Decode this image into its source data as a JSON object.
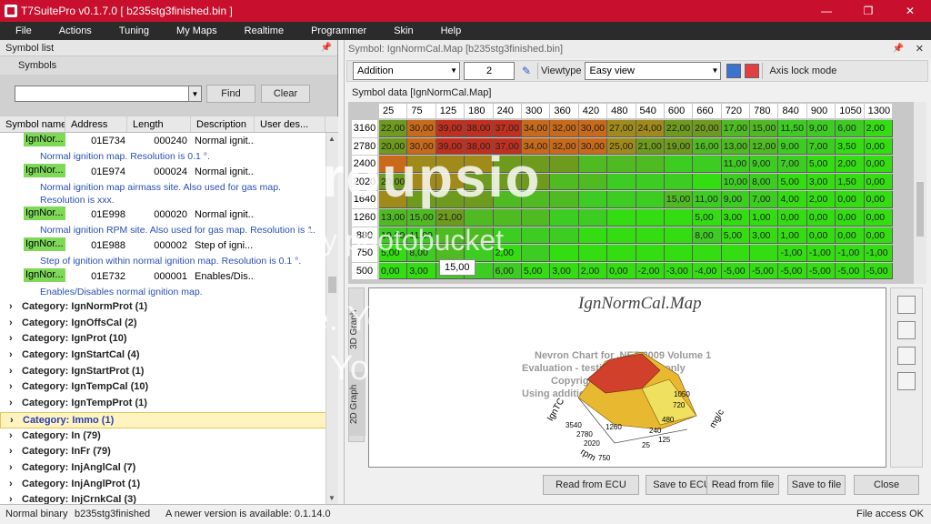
{
  "window": {
    "title": "T7SuitePro v0.1.7.0 [ b235stg3finished.bin ]",
    "min_glyph": "—",
    "max_glyph": "❐",
    "close_glyph": "✕"
  },
  "menu": [
    "File",
    "Actions",
    "Tuning",
    "My Maps",
    "Realtime",
    "Programmer",
    "Skin",
    "Help"
  ],
  "left": {
    "header": "Symbol list",
    "tab": "Symbols",
    "find_label": "Find",
    "clear_label": "Clear",
    "columns": [
      "Symbol name",
      "Address",
      "Length",
      "Description",
      "User des..."
    ],
    "symbols": [
      {
        "name": "IgnNor...",
        "address": "01E734",
        "length": "000240",
        "desc": "Normal ignit...",
        "detail": "Normal ignition map. Resolution is 0.1 °."
      },
      {
        "name": "IgnNor...",
        "address": "01E974",
        "length": "000024",
        "desc": "Normal ignit...",
        "detail": "Normal ignition map airmass site. Also used for gas map. Resolution is xxx."
      },
      {
        "name": "IgnNor...",
        "address": "01E998",
        "length": "000020",
        "desc": "Normal ignit...",
        "detail": "Normal ignition RPM site. Also used for gas map. Resolution is 1."
      },
      {
        "name": "IgnNor...",
        "address": "01E988",
        "length": "000002",
        "desc": "Step of igni...",
        "detail": "Step of ignition within normal ignition map. Resolution is 0.1 °."
      },
      {
        "name": "IgnNor...",
        "address": "01E732",
        "length": "000001",
        "desc": "Enables/Dis...",
        "detail": "Enables/Disables normal ignition map."
      }
    ],
    "categories": [
      "Category: IgnNormProt (1)",
      "Category: IgnOffsCal (2)",
      "Category: IgnProt (10)",
      "Category: IgnStartCal (4)",
      "Category: IgnStartProt (1)",
      "Category: IgnTempCal (10)",
      "Category: IgnTempProt (1)",
      "Category: Immo (1)",
      "Category: In (79)",
      "Category: InFr (79)",
      "Category: InjAnglCal (7)",
      "Category: InjAnglProt (1)",
      "Category: InjCrnkCal (3)"
    ],
    "selected_category": 7
  },
  "right": {
    "header": "Symbol: IgnNormCal.Map [b235stg3finished.bin]",
    "operation": "Addition",
    "value": "2",
    "viewtype_label": "Viewtype",
    "viewtype": "Easy view",
    "axislock_label": "Axis lock mode",
    "symdata_title": "Symbol data [IgnNormCal.Map]",
    "tooltip": "15,00",
    "graph_title": "IgnNormCal.Map",
    "graph_watermark": [
      "Nevron Chart for .NET 2009 Volume 1",
      "Evaluation - testing purposes only",
      "Copyright 1998 - 2009",
      "Using additionally licensed edition"
    ],
    "graph_axes": {
      "rpm": "rpm",
      "igntc": "IgnTC",
      "mgc": "mg/c"
    },
    "graph_ticks_rpm": [
      "3540",
      "2780",
      "2020",
      "1260",
      "750"
    ],
    "graph_ticks_mgc": [
      "1050",
      "720",
      "480",
      "240",
      "125",
      "25"
    ],
    "tab_3d": "3D Graph",
    "tab_2d": "2D Graph",
    "buttons": [
      "Read from ECU",
      "Save to ECU",
      "Read from file",
      "Save to file",
      "Close"
    ],
    "grid": {
      "columns": [
        "25",
        "75",
        "125",
        "180",
        "240",
        "300",
        "360",
        "420",
        "480",
        "540",
        "600",
        "660",
        "720",
        "780",
        "840",
        "900",
        "1050",
        "1300"
      ],
      "rows": [
        "3160",
        "2780",
        "2400",
        "2020",
        "1640",
        "1260",
        "880",
        "750",
        "500"
      ],
      "values": [
        [
          "22,00",
          "30,00",
          "39,00",
          "38,00",
          "37,00",
          "34,00",
          "32,00",
          "30,00",
          "27,00",
          "24,00",
          "22,00",
          "20,00",
          "17,00",
          "15,00",
          "11,50",
          "9,00",
          "6,00",
          "2,00"
        ],
        [
          "20,00",
          "30,00",
          "39,00",
          "38,00",
          "37,00",
          "34,00",
          "32,00",
          "30,00",
          "25,00",
          "21,00",
          "19,00",
          "16,00",
          "13,00",
          "12,00",
          "9,00",
          "7,00",
          "3,50",
          "0,00"
        ],
        [
          "",
          "",
          "",
          "",
          "",
          "",
          "",
          "",
          "",
          "",
          "",
          "",
          "11,00",
          "9,00",
          "7,00",
          "5,00",
          "2,00",
          "0,00"
        ],
        [
          "20,00",
          "",
          "",
          "",
          "",
          "",
          "",
          "",
          "",
          "",
          "",
          "",
          "10,00",
          "8,00",
          "5,00",
          "3,00",
          "1,50",
          "0,00"
        ],
        [
          "",
          "",
          "",
          "",
          "",
          "",
          "",
          "",
          "",
          "",
          "15,00",
          "11,00",
          "9,00",
          "7,00",
          "4,00",
          "2,00",
          "0,00",
          "0,00"
        ],
        [
          "13,00",
          "15,00",
          "21,00",
          "",
          "",
          "",
          "",
          "",
          "",
          "",
          "",
          "5,00",
          "3,00",
          "1,00",
          "0,00",
          "0,00",
          "0,00",
          "0,00"
        ],
        [
          "10,00",
          "11,00",
          "",
          "",
          "",
          "",
          "",
          "",
          "",
          "",
          "",
          "8,00",
          "5,00",
          "3,00",
          "1,00",
          "0,00",
          "0,00",
          "0,00"
        ],
        [
          "5,00",
          "8,00",
          "",
          "",
          "2,00",
          "",
          "",
          "",
          "",
          "",
          "",
          "",
          "",
          "",
          "-1,00",
          "-1,00",
          "-1,00",
          "-1,00"
        ],
        [
          "0,00",
          "3,00",
          "",
          "",
          "6,00",
          "5,00",
          "3,00",
          "2,00",
          "0,00",
          "-2,00",
          "-3,00",
          "-4,00",
          "-5,00",
          "-5,00",
          "-5,00",
          "-5,00",
          "-5,00",
          "-5,00"
        ]
      ]
    }
  },
  "status": {
    "mode": "Normal binary",
    "file": "b235stg3finished",
    "update": "A newer version is available: 0.1.14.0",
    "access": "File access OK"
  },
  "overlay": {
    "logo": "Groupsio",
    "by": "by photobucket",
    "tag1": "Your people. Your moments.",
    "tag2": "Your space."
  }
}
